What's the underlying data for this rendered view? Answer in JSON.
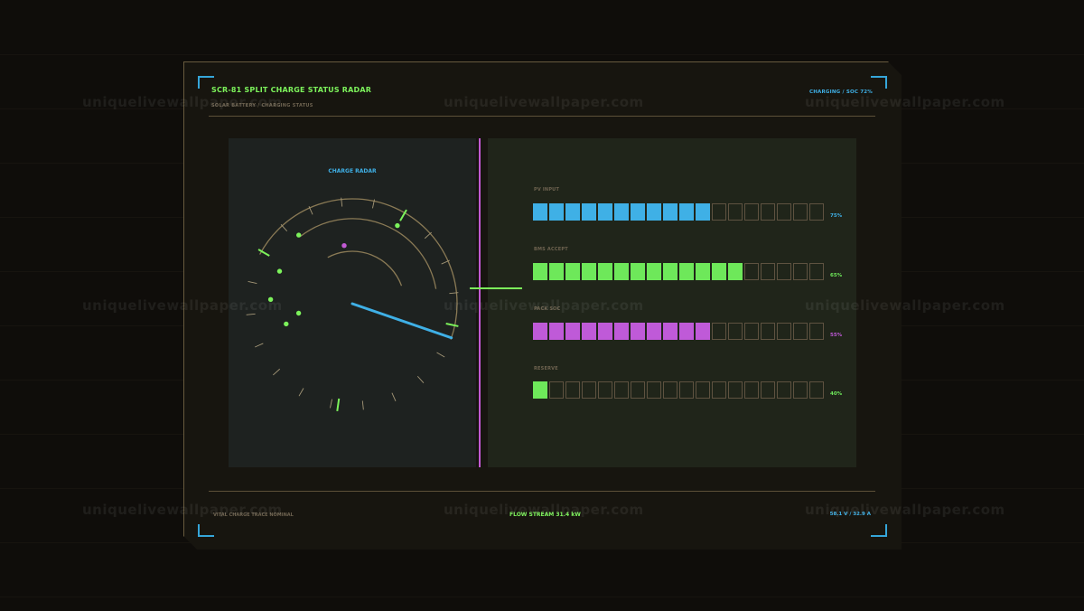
{
  "header": {
    "title": "SCR-81  SPLIT CHARGE STATUS RADAR",
    "subtitle": "SOLAR BATTERY / CHARGING STATUS",
    "status": "CHARGING  /  SOC 72%"
  },
  "radar": {
    "title": "CHARGE RADAR",
    "sweep_angle_deg": -19,
    "dots": [
      {
        "angle_deg": 98,
        "radius_frac": 0.56,
        "color": "#c25ad4"
      },
      {
        "angle_deg": 60,
        "radius_frac": 0.86,
        "color": "#7cf25b"
      },
      {
        "angle_deg": 128,
        "radius_frac": 0.83,
        "color": "#7cf25b"
      },
      {
        "angle_deg": 156,
        "radius_frac": 0.76,
        "color": "#7cf25b"
      },
      {
        "angle_deg": 177,
        "radius_frac": 0.78,
        "color": "#7cf25b"
      },
      {
        "angle_deg": 197,
        "radius_frac": 0.66,
        "color": "#7cf25b"
      },
      {
        "angle_deg": 190,
        "radius_frac": 0.52,
        "color": "#7cf25b"
      }
    ]
  },
  "rows": [
    {
      "label": "PV INPUT",
      "percent_label": "75%",
      "filled": 11,
      "total": 18,
      "color": "#3fb0e6"
    },
    {
      "label": "BMS ACCEPT",
      "percent_label": "65%",
      "filled": 13,
      "total": 18,
      "color": "#6ee85a"
    },
    {
      "label": "PACK SOC",
      "percent_label": "55%",
      "filled": 11,
      "total": 18,
      "color": "#bf5ad8"
    },
    {
      "label": "RESERVE",
      "percent_label": "40%",
      "filled": 1,
      "total": 18,
      "color": "#6ee85a"
    }
  ],
  "footer": {
    "left": "VITAL CHARGE TRACE NOMINAL",
    "mid": "FLOW STREAM 31.4 kW",
    "right": "58.1 V / 32.9 A"
  },
  "watermark": "uniquelivewallpaper.com",
  "colors": {
    "accent_green": "#7cf25b",
    "accent_blue": "#3fb0e6",
    "accent_magenta": "#c25ad4",
    "frame": "#675a3e"
  }
}
